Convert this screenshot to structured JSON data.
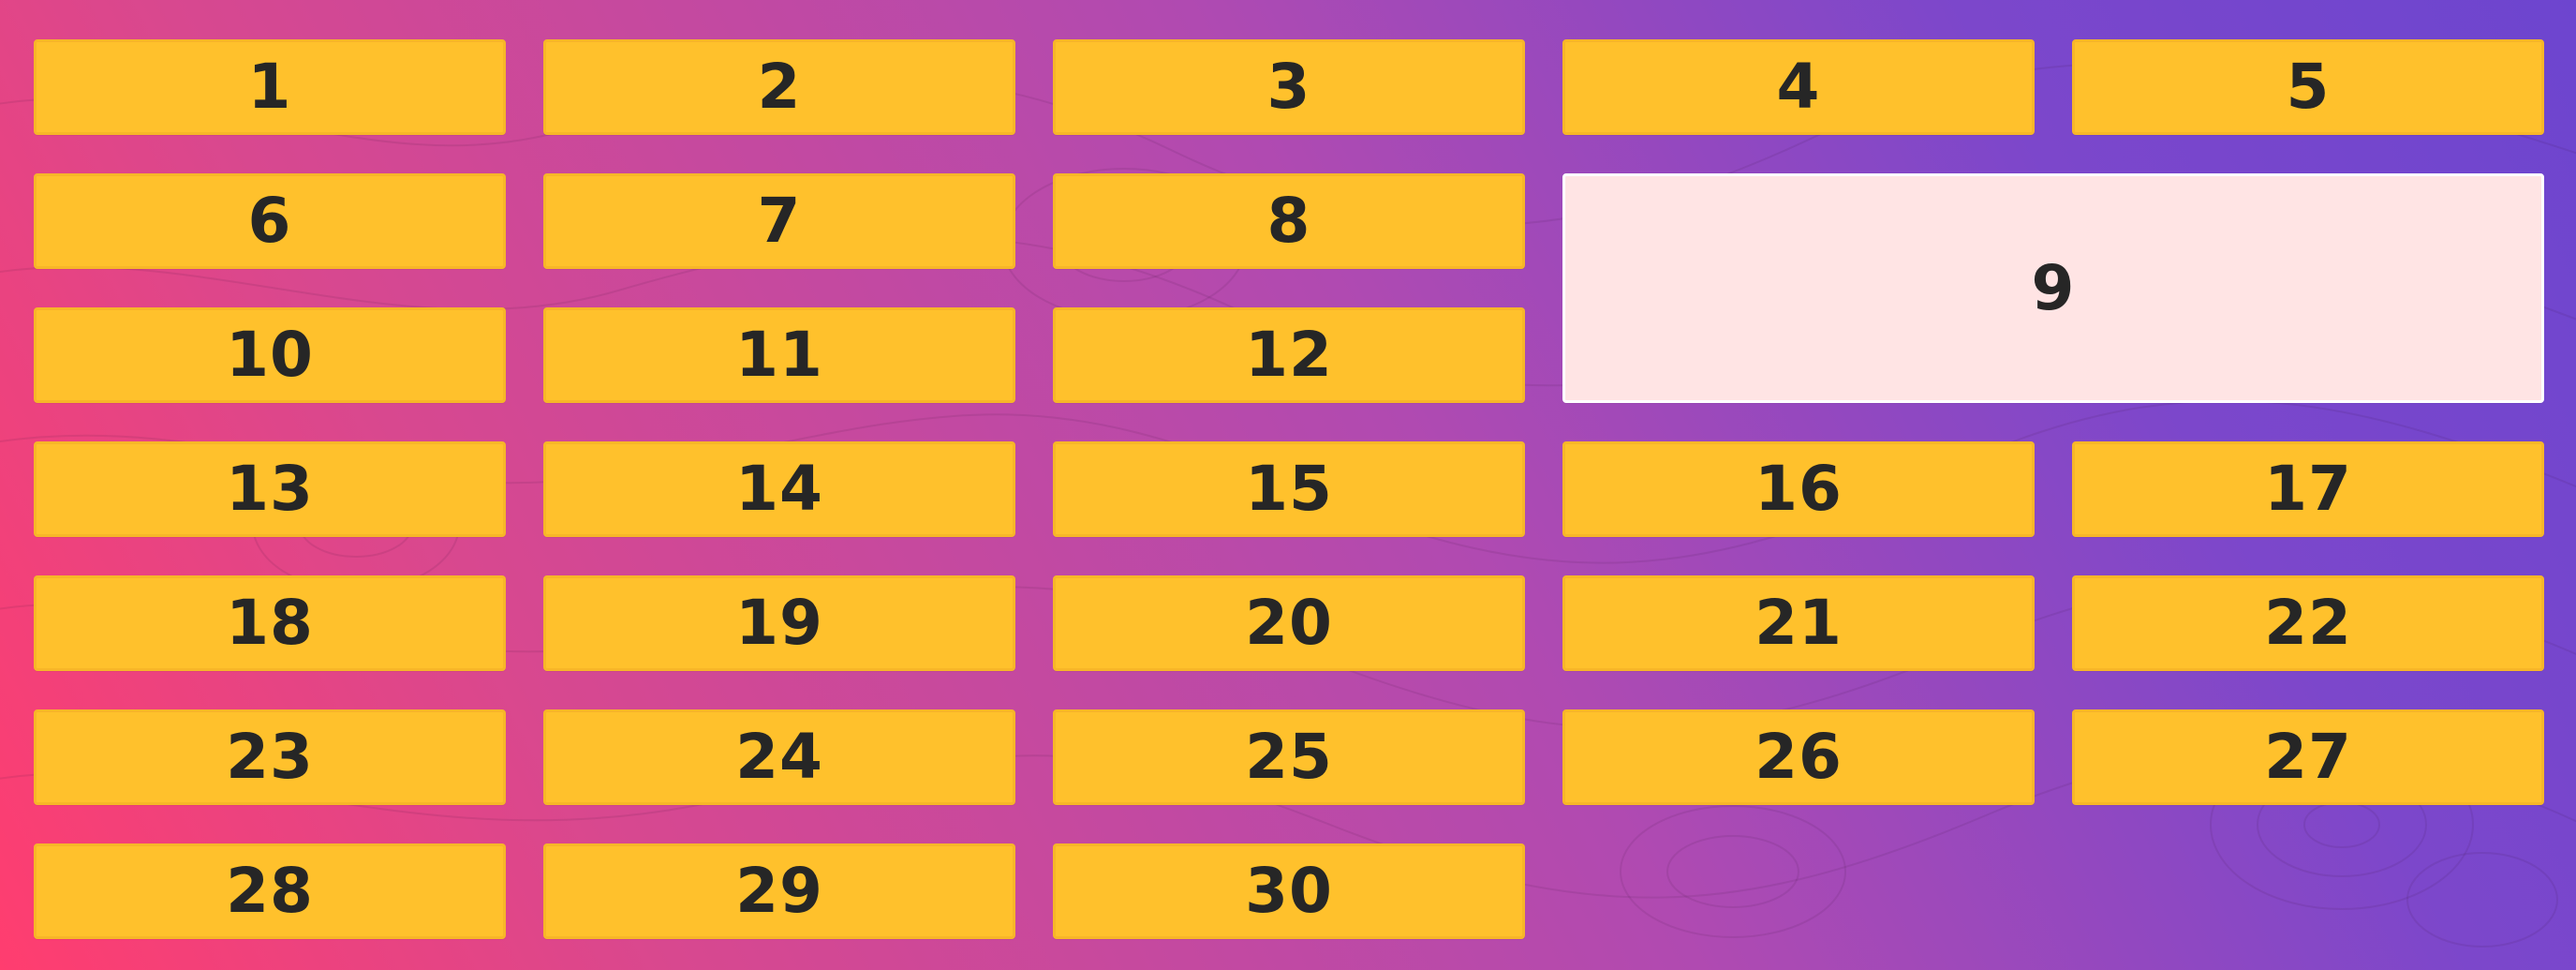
{
  "tiles": [
    {
      "label": "1"
    },
    {
      "label": "2"
    },
    {
      "label": "3"
    },
    {
      "label": "4"
    },
    {
      "label": "5"
    },
    {
      "label": "6"
    },
    {
      "label": "7"
    },
    {
      "label": "8"
    },
    {
      "label": "9",
      "featured": true
    },
    {
      "label": "10"
    },
    {
      "label": "11"
    },
    {
      "label": "12"
    },
    {
      "label": "13"
    },
    {
      "label": "14"
    },
    {
      "label": "15"
    },
    {
      "label": "16"
    },
    {
      "label": "17"
    },
    {
      "label": "18"
    },
    {
      "label": "19"
    },
    {
      "label": "20"
    },
    {
      "label": "21"
    },
    {
      "label": "22"
    },
    {
      "label": "23"
    },
    {
      "label": "24"
    },
    {
      "label": "25"
    },
    {
      "label": "26"
    },
    {
      "label": "27"
    },
    {
      "label": "28"
    },
    {
      "label": "29"
    },
    {
      "label": "30"
    }
  ],
  "colors": {
    "tile": "#ffc12c",
    "tile_featured": "#ffe4e4",
    "text": "#262626",
    "background_start": "#ff3d6f",
    "background_end": "#6d45cf"
  }
}
